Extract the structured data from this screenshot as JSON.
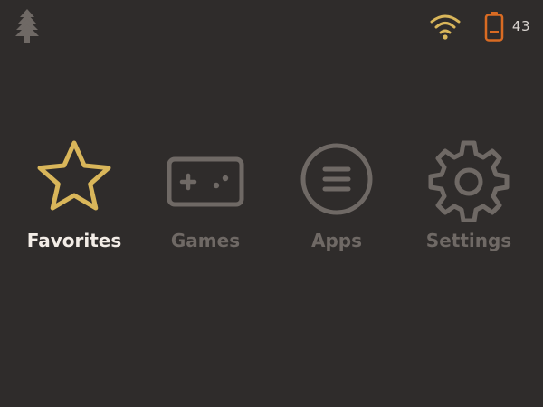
{
  "status_bar": {
    "battery_percent": "43",
    "logo_icon": "tree-icon",
    "wifi_icon": "wifi-icon",
    "battery_icon": "battery-icon"
  },
  "colors": {
    "background": "#2f2c2b",
    "selected_accent": "#d9b65a",
    "inactive": "#6f6965",
    "selected_label": "#f3ede7",
    "battery": "#d96b23",
    "logo": "#6f6965"
  },
  "menu": {
    "selected_index": 0,
    "items": [
      {
        "label": "Favorites",
        "icon": "star-icon"
      },
      {
        "label": "Games",
        "icon": "gamepad-icon"
      },
      {
        "label": "Apps",
        "icon": "apps-icon"
      },
      {
        "label": "Settings",
        "icon": "gear-icon"
      }
    ]
  }
}
